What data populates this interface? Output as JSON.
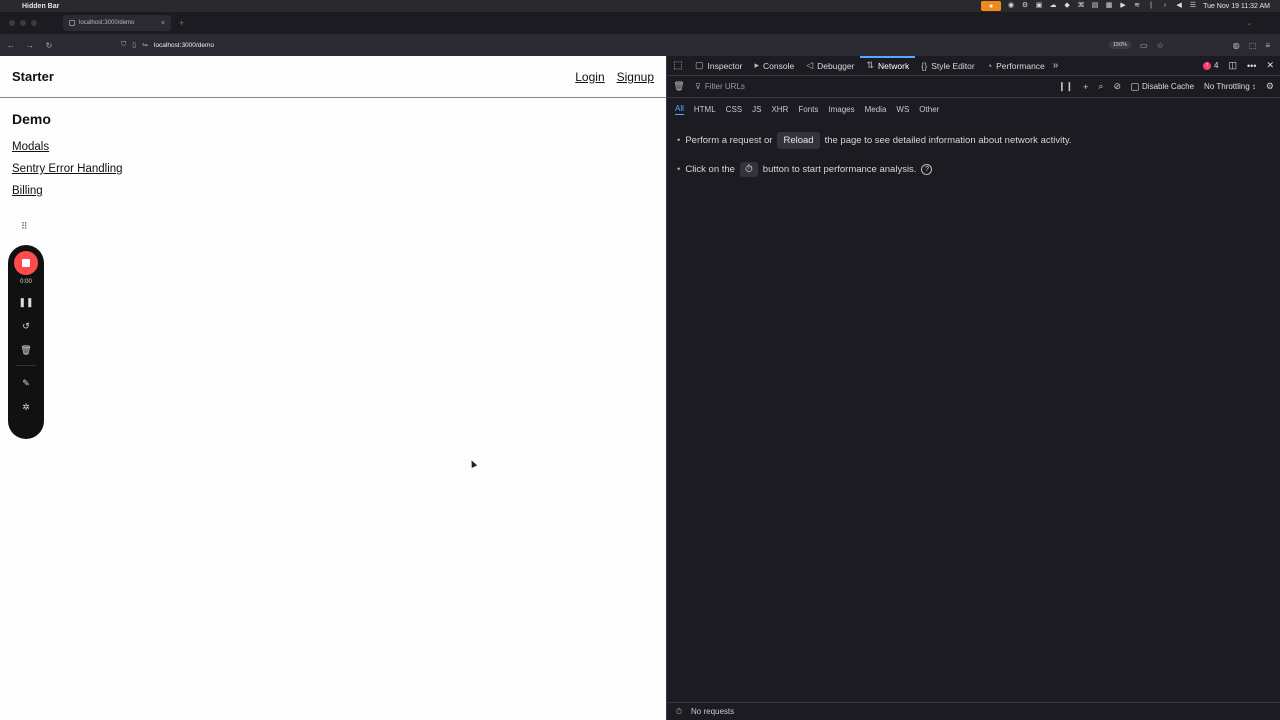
{
  "menubar": {
    "app_name": "Hidden Bar",
    "datetime": "Tue Nov 19  11:32 AM"
  },
  "browser": {
    "tab_title": "localhost:3000/demo",
    "url": "localhost:3000/demo",
    "zoom": "150%"
  },
  "page": {
    "brand": "Starter",
    "nav": {
      "login": "Login",
      "signup": "Signup"
    },
    "heading": "Demo",
    "links": [
      "Modals",
      "Sentry Error Handling",
      "Billing"
    ]
  },
  "recorder": {
    "time": "0:00"
  },
  "devtools": {
    "tabs": [
      "Inspector",
      "Console",
      "Debugger",
      "Network",
      "Style Editor",
      "Performance"
    ],
    "active_tab": "Network",
    "error_count": "4",
    "filter_placeholder": "Filter URLs",
    "disable_cache": "Disable Cache",
    "throttling": "No Throttling ↕",
    "type_filters": [
      "All",
      "HTML",
      "CSS",
      "JS",
      "XHR",
      "Fonts",
      "Images",
      "Media",
      "WS",
      "Other"
    ],
    "message1": {
      "pre": "Perform a request or",
      "button": "Reload",
      "post": "the page to see detailed information about network activity."
    },
    "message2": {
      "pre": "Click on the",
      "post": "button to start performance analysis."
    },
    "status": "No requests"
  }
}
